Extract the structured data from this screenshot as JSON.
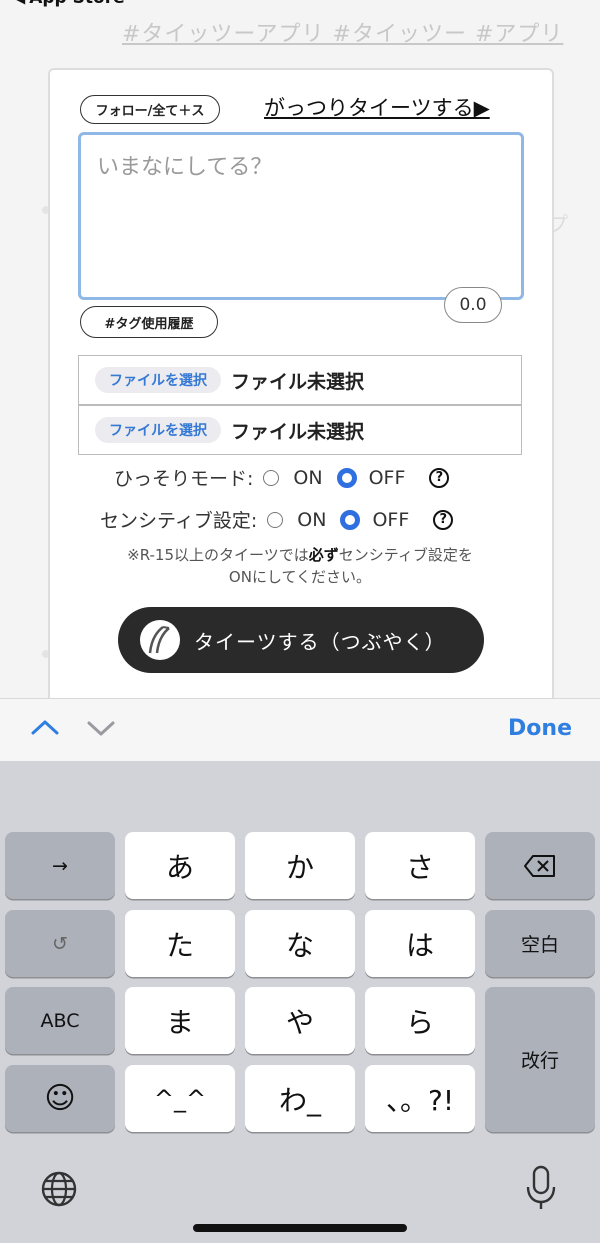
{
  "background": {
    "back_label": "App Store",
    "hashtags": "#タイッツーアプリ #タイッツー #アプリ"
  },
  "composer": {
    "follow_label": "フォロー/全て＋ス",
    "full_link": "がっつりタイーツする▶",
    "placeholder": "いまなにしてる？",
    "counter": "0.0",
    "tag_history_label": "#タグ使用履歴",
    "files": [
      {
        "button": "ファイルを選択",
        "status": "ファイル未選択"
      },
      {
        "button": "ファイルを選択",
        "status": "ファイル未選択"
      }
    ],
    "stealth": {
      "label": "ひっそりモード:",
      "on": "ON",
      "off": "OFF",
      "selected": "OFF",
      "help": "?"
    },
    "sensitive": {
      "label": "センシティブ設定:",
      "on": "ON",
      "off": "OFF",
      "selected": "OFF",
      "help": "?"
    },
    "note_line1_before": "※R-15以上のタイーツでは",
    "note_emphasis": "必ず",
    "note_line1_after": "センシティブ設定を",
    "note_line2": "ONにしてください。",
    "submit_label": "タイーツする（つぶやく）"
  },
  "accessory": {
    "up": "up-chevron",
    "down": "down-chevron",
    "done": "Done"
  },
  "keyboard": {
    "row1": [
      "→",
      "あ",
      "か",
      "さ",
      "⌫"
    ],
    "row2": [
      "↺",
      "た",
      "な",
      "は",
      "空白"
    ],
    "row3": [
      "ABC",
      "ま",
      "や",
      "ら"
    ],
    "row4": [
      "☺",
      "^_^",
      "わ_",
      "、。?!"
    ],
    "enter": "改行",
    "globe": "globe-icon",
    "mic": "mic-icon"
  },
  "colors": {
    "accent": "#2f7ee0",
    "radio": "#2f6fe0",
    "focus": "#8fb8e6",
    "button_dark": "#2a2a2a"
  }
}
